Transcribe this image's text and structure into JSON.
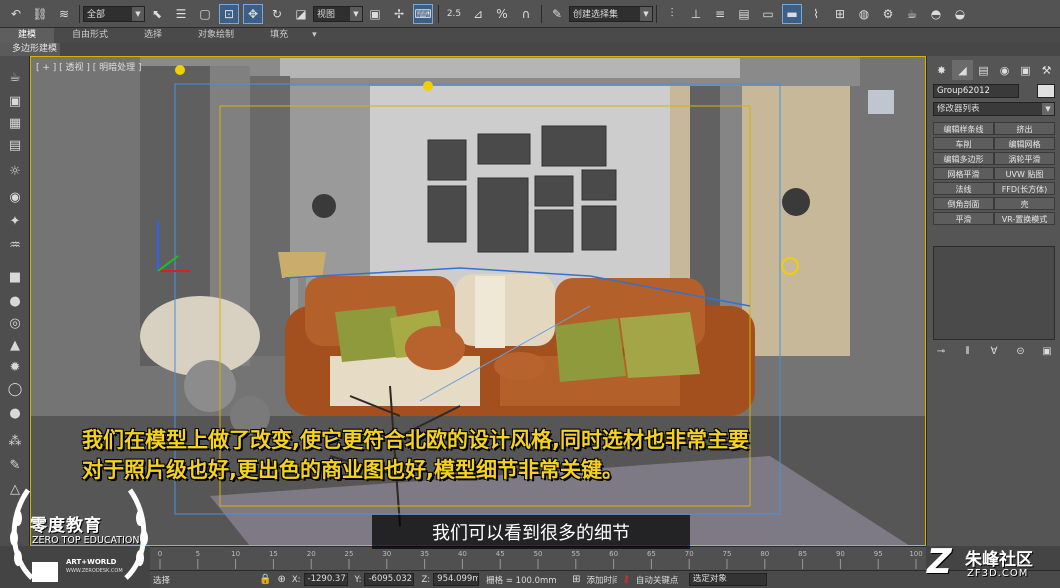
{
  "toolbar": {
    "selection_filter": "全部",
    "reference_coord": "视图",
    "named_selection_placeholder": "创建选择集",
    "snap_label": "2.5",
    "angle_snap": "⊿",
    "percent_snap": "%",
    "spinner_snap": "∩"
  },
  "ribbon": {
    "tabs": [
      "建模",
      "自由形式",
      "选择",
      "对象绘制",
      "填充"
    ],
    "active_tab": "建模",
    "sub_label": "多边形建模"
  },
  "viewport": {
    "label": "[ + ] [ 透视 ] [ 明暗处理 ]"
  },
  "subtitles": {
    "line1": "我们在模型上做了改变,使它更符合北欧的设计风格,同时选材也非常主要",
    "line2": "对于照片级也好,更出色的商业图也好,模型细节非常关键。",
    "caption": "我们可以看到很多的细节"
  },
  "logo": {
    "title": "零度教育",
    "subtitle": "ZERO TOP EDUCATION",
    "art_world": "ART+WORLD",
    "url": "WWW.ZERODESK.COM"
  },
  "command_panel": {
    "object_name": "Group62012",
    "modifier_list": "修改器列表",
    "object_color": "#e0e0e0",
    "buttons": [
      "编辑样条线",
      "挤出",
      "车削",
      "编辑网格",
      "编辑多边形",
      "涡轮平滑",
      "网格平滑",
      "UVW 贴图",
      "法线",
      "FFD(长方体)",
      "倒角剖面",
      "壳",
      "平滑",
      "VR-置换模式"
    ]
  },
  "timeline": {
    "ticks": [
      "0",
      "5",
      "10",
      "15",
      "20",
      "25",
      "30",
      "35",
      "40",
      "45",
      "50",
      "55",
      "60",
      "65",
      "70",
      "75",
      "80",
      "85",
      "90",
      "95",
      "100"
    ]
  },
  "status": {
    "selected": "选择",
    "x_label": "X:",
    "x_value": "-1290.371",
    "y_label": "Y:",
    "y_value": "-6095.032",
    "z_label": "Z:",
    "z_value": "954.099m",
    "grid": "栅格 = 100.0mm",
    "auto_key": "自动关键点",
    "set_key_filter": "选定对象",
    "add_time_tag": "添加时间标记"
  },
  "watermark": {
    "brand": "朱峰社区",
    "url": "ZF3D.COM"
  },
  "colors": {
    "subtitle": "#f4d21f",
    "viewport_border": "#d9b200",
    "selection": "#3d5f86"
  }
}
